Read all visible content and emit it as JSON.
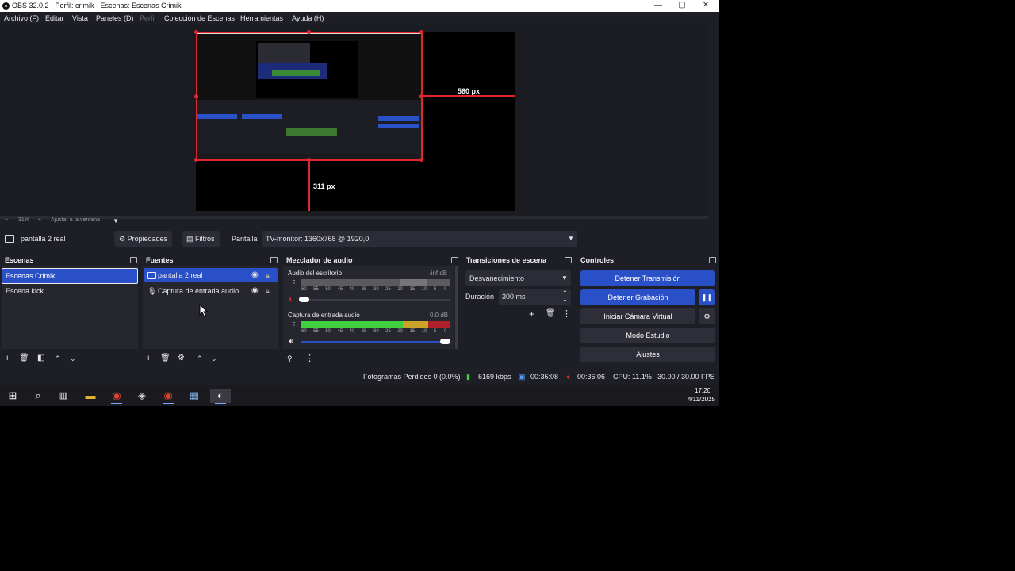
{
  "window": {
    "title": "OBS 32.0.2 - Perfil: crimik - Escenas: Escenas Crimik",
    "minimize": "—",
    "maximize": "▢",
    "close": "✕"
  },
  "menu": [
    "Archivo (F)",
    "Editar",
    "Vista",
    "Paneles (D)",
    "Perfil",
    "Colección de Escenas",
    "Herramientas",
    "Ayuda (H)"
  ],
  "preview": {
    "width_label": "560 px",
    "height_label": "311 px",
    "zoom": "31%",
    "fit_label": "Ajustar a la ventana"
  },
  "source_toolbar": {
    "source_name": "pantalla 2 real",
    "properties": "Propiedades",
    "filters": "Filtros",
    "display_label": "Pantalla",
    "display_value": "TV-monitor: 1360x768 @ 1920,0"
  },
  "scenes": {
    "title": "Escenas",
    "items": [
      "Escenas Crimik",
      "Escena kick"
    ]
  },
  "sources": {
    "title": "Fuentes",
    "items": [
      "pantalla 2 real",
      "Captura de entrada audio"
    ]
  },
  "mixer": {
    "title": "Mezclador de audio",
    "channels": [
      {
        "name": "Audio del escritorio",
        "level": "-inf dB"
      },
      {
        "name": "Captura de entrada audio",
        "level": "0.0 dB"
      }
    ],
    "scale": [
      "-60",
      "-55",
      "-50",
      "-45",
      "-40",
      "-35",
      "-30",
      "-25",
      "-20",
      "-15",
      "-10",
      "-5",
      "0"
    ]
  },
  "transitions": {
    "title": "Transiciones de escena",
    "type": "Desvanecimiento",
    "duration_label": "Duración",
    "duration_value": "300 ms"
  },
  "controls": {
    "title": "Controles",
    "stop_stream": "Detener Transmisión",
    "stop_record": "Detener Grabación",
    "virtual_cam": "Iniciar Cámara Virtual",
    "studio_mode": "Modo Estudio",
    "settings": "Ajustes"
  },
  "status": {
    "dropped": "Fotogramas Perdidos 0 (0.0%)",
    "bitrate": "6169 kbps",
    "stream_time": "00:36:08",
    "rec_time": "00:36:06",
    "cpu": "CPU: 11.1%",
    "fps": "30.00 / 30.00 FPS"
  },
  "taskbar": {
    "time": "17:20",
    "date": "4/11/2025"
  },
  "colors": {
    "accent_blue": "#2a50c8",
    "guide_red": "#e0262e",
    "meter_green": "#3fcf3f",
    "meter_yellow": "#c9a227",
    "meter_red": "#b0202a"
  }
}
